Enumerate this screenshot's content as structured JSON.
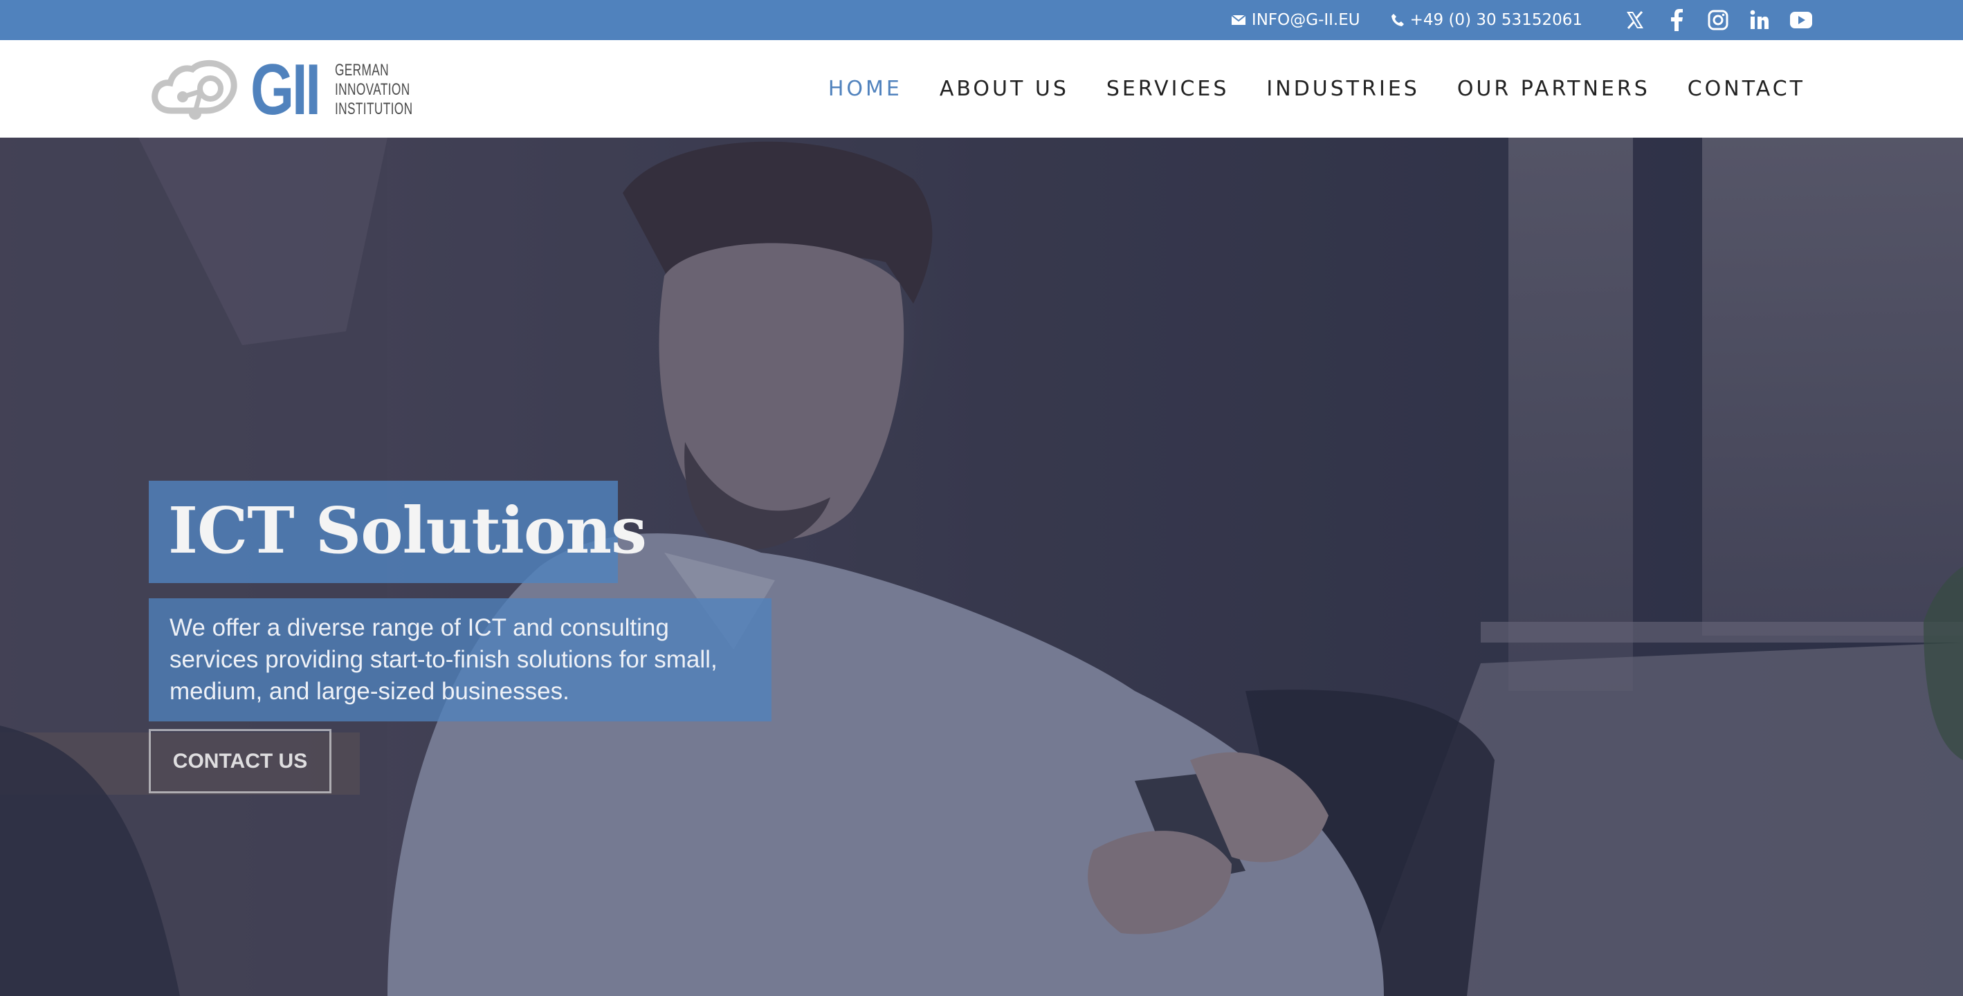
{
  "topbar": {
    "email": "INFO@G-II.EU",
    "phone": "+49 (0) 30 53152061",
    "socials": [
      "x-icon",
      "facebook-icon",
      "instagram-icon",
      "linkedin-icon",
      "youtube-icon"
    ],
    "bg_color": "#5082bd"
  },
  "logo": {
    "mark": "GII",
    "line1": "GERMAN",
    "line2": "INNOVATION",
    "line3": "INSTITUTION"
  },
  "nav": {
    "items": [
      {
        "label": "HOME",
        "active": true
      },
      {
        "label": "ABOUT US",
        "active": false
      },
      {
        "label": "SERVICES",
        "active": false
      },
      {
        "label": "INDUSTRIES",
        "active": false
      },
      {
        "label": "OUR PARTNERS",
        "active": false
      },
      {
        "label": "CONTACT",
        "active": false
      }
    ],
    "accent_color": "#5082bd"
  },
  "hero": {
    "title": "ICT Solutions",
    "description": "We offer a diverse range of ICT and consulting services providing start-to-finish solutions for small, medium, and large-sized businesses.",
    "button_label": "CONTACT US"
  }
}
